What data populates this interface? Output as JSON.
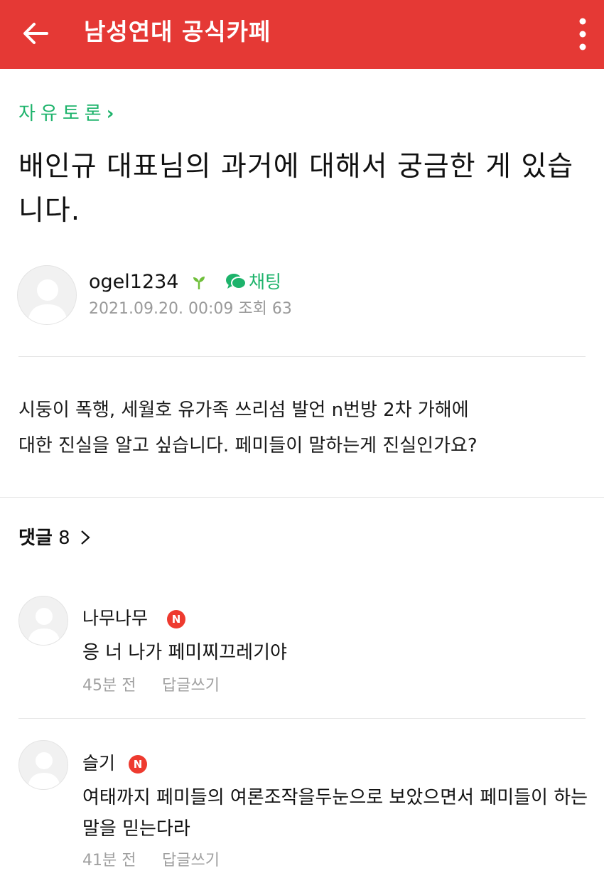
{
  "appbar": {
    "title": "남성연대 공식카페",
    "back_icon": "arrow-left-icon",
    "more_icon": "more-vertical-icon",
    "color": "#e53935"
  },
  "post": {
    "category": "자유토론",
    "category_color": "#1db36b",
    "title": "배인규 대표님의 과거에 대해서 궁금한 게 있습니다.",
    "author": {
      "name": "ogel1234",
      "level_icon": "sprout-icon",
      "chat_label": "채팅",
      "date": "2021.09.20. 00:09",
      "views_label": "조회",
      "views": "63"
    },
    "body_lines": [
      "시둥이 폭행, 세월호 유가족 쓰리섬 발언 n번방 2차 가해에",
      "대한 진실을 알고 싶습니다. 페미들이 말하는게 진실인가요?"
    ]
  },
  "comments_section": {
    "label": "댓글",
    "count": "8"
  },
  "comments": [
    {
      "name": "나무나무",
      "badge": "N",
      "text": "응 너 나가 페미찌끄레기야",
      "time": "45분 전",
      "reply_label": "답글쓰기"
    },
    {
      "name": "슬기",
      "badge": "N",
      "text": "여태까지 페미들의 여론조작을두눈으로 보았으면서 페미들이 하는말을 믿는다라",
      "time": "41분 전",
      "reply_label": "답글쓰기"
    }
  ]
}
